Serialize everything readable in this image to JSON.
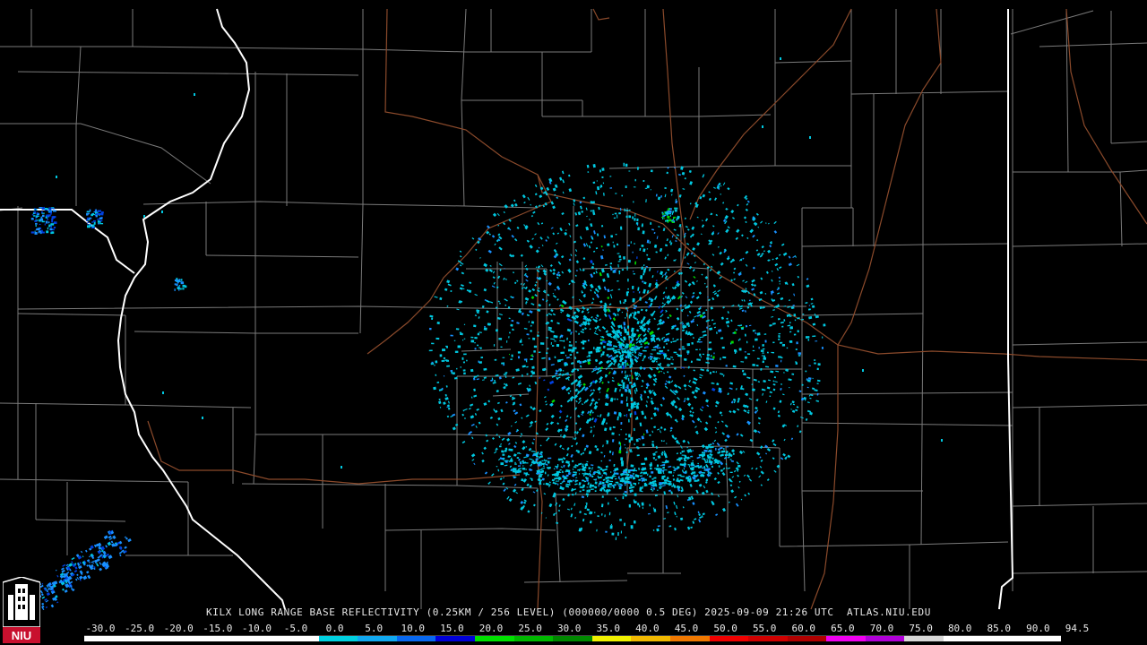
{
  "product": {
    "caption": "KILX LONG RANGE BASE REFLECTIVITY (0.25KM / 256 LEVEL) (000000/0000 0.5 DEG) 2025-09-09 21:26 UTC  ATLAS.NIU.EDU"
  },
  "logo": {
    "text": "NIU",
    "icon": "university-tower-logo",
    "color": "#c8102e"
  },
  "legend": {
    "labels": [
      "-30.0",
      "-25.0",
      "-20.0",
      "-15.0",
      "-10.0",
      "-5.0",
      "0.0",
      "5.0",
      "10.0",
      "15.0",
      "20.0",
      "25.0",
      "30.0",
      "35.0",
      "40.0",
      "45.0",
      "50.0",
      "55.0",
      "60.0",
      "65.0",
      "70.0",
      "75.0",
      "80.0",
      "85.0",
      "90.0",
      "94.5"
    ],
    "colors": [
      "#ffffff",
      "#ffffff",
      "#ffffff",
      "#ffffff",
      "#ffffff",
      "#ffffff",
      "#00d0e0",
      "#10a8f0",
      "#0868f0",
      "#0000d8",
      "#00e000",
      "#00b800",
      "#008800",
      "#f0f000",
      "#f0b800",
      "#f07800",
      "#f00000",
      "#d00000",
      "#b00000",
      "#f000f0",
      "#b000d8",
      "#d8d8d8",
      "#ffffff",
      "#ffffff",
      "#ffffff"
    ]
  },
  "map": {
    "colors": {
      "background": "#000000",
      "county_lines": "#7a7a7a",
      "state_lines": "#ffffff",
      "highways": "#8b4a2b",
      "echo_light": "#00c8e0",
      "echo_mid": "#1890ff",
      "echo_blue": "#0040e0",
      "echo_green": "#00d800"
    }
  }
}
